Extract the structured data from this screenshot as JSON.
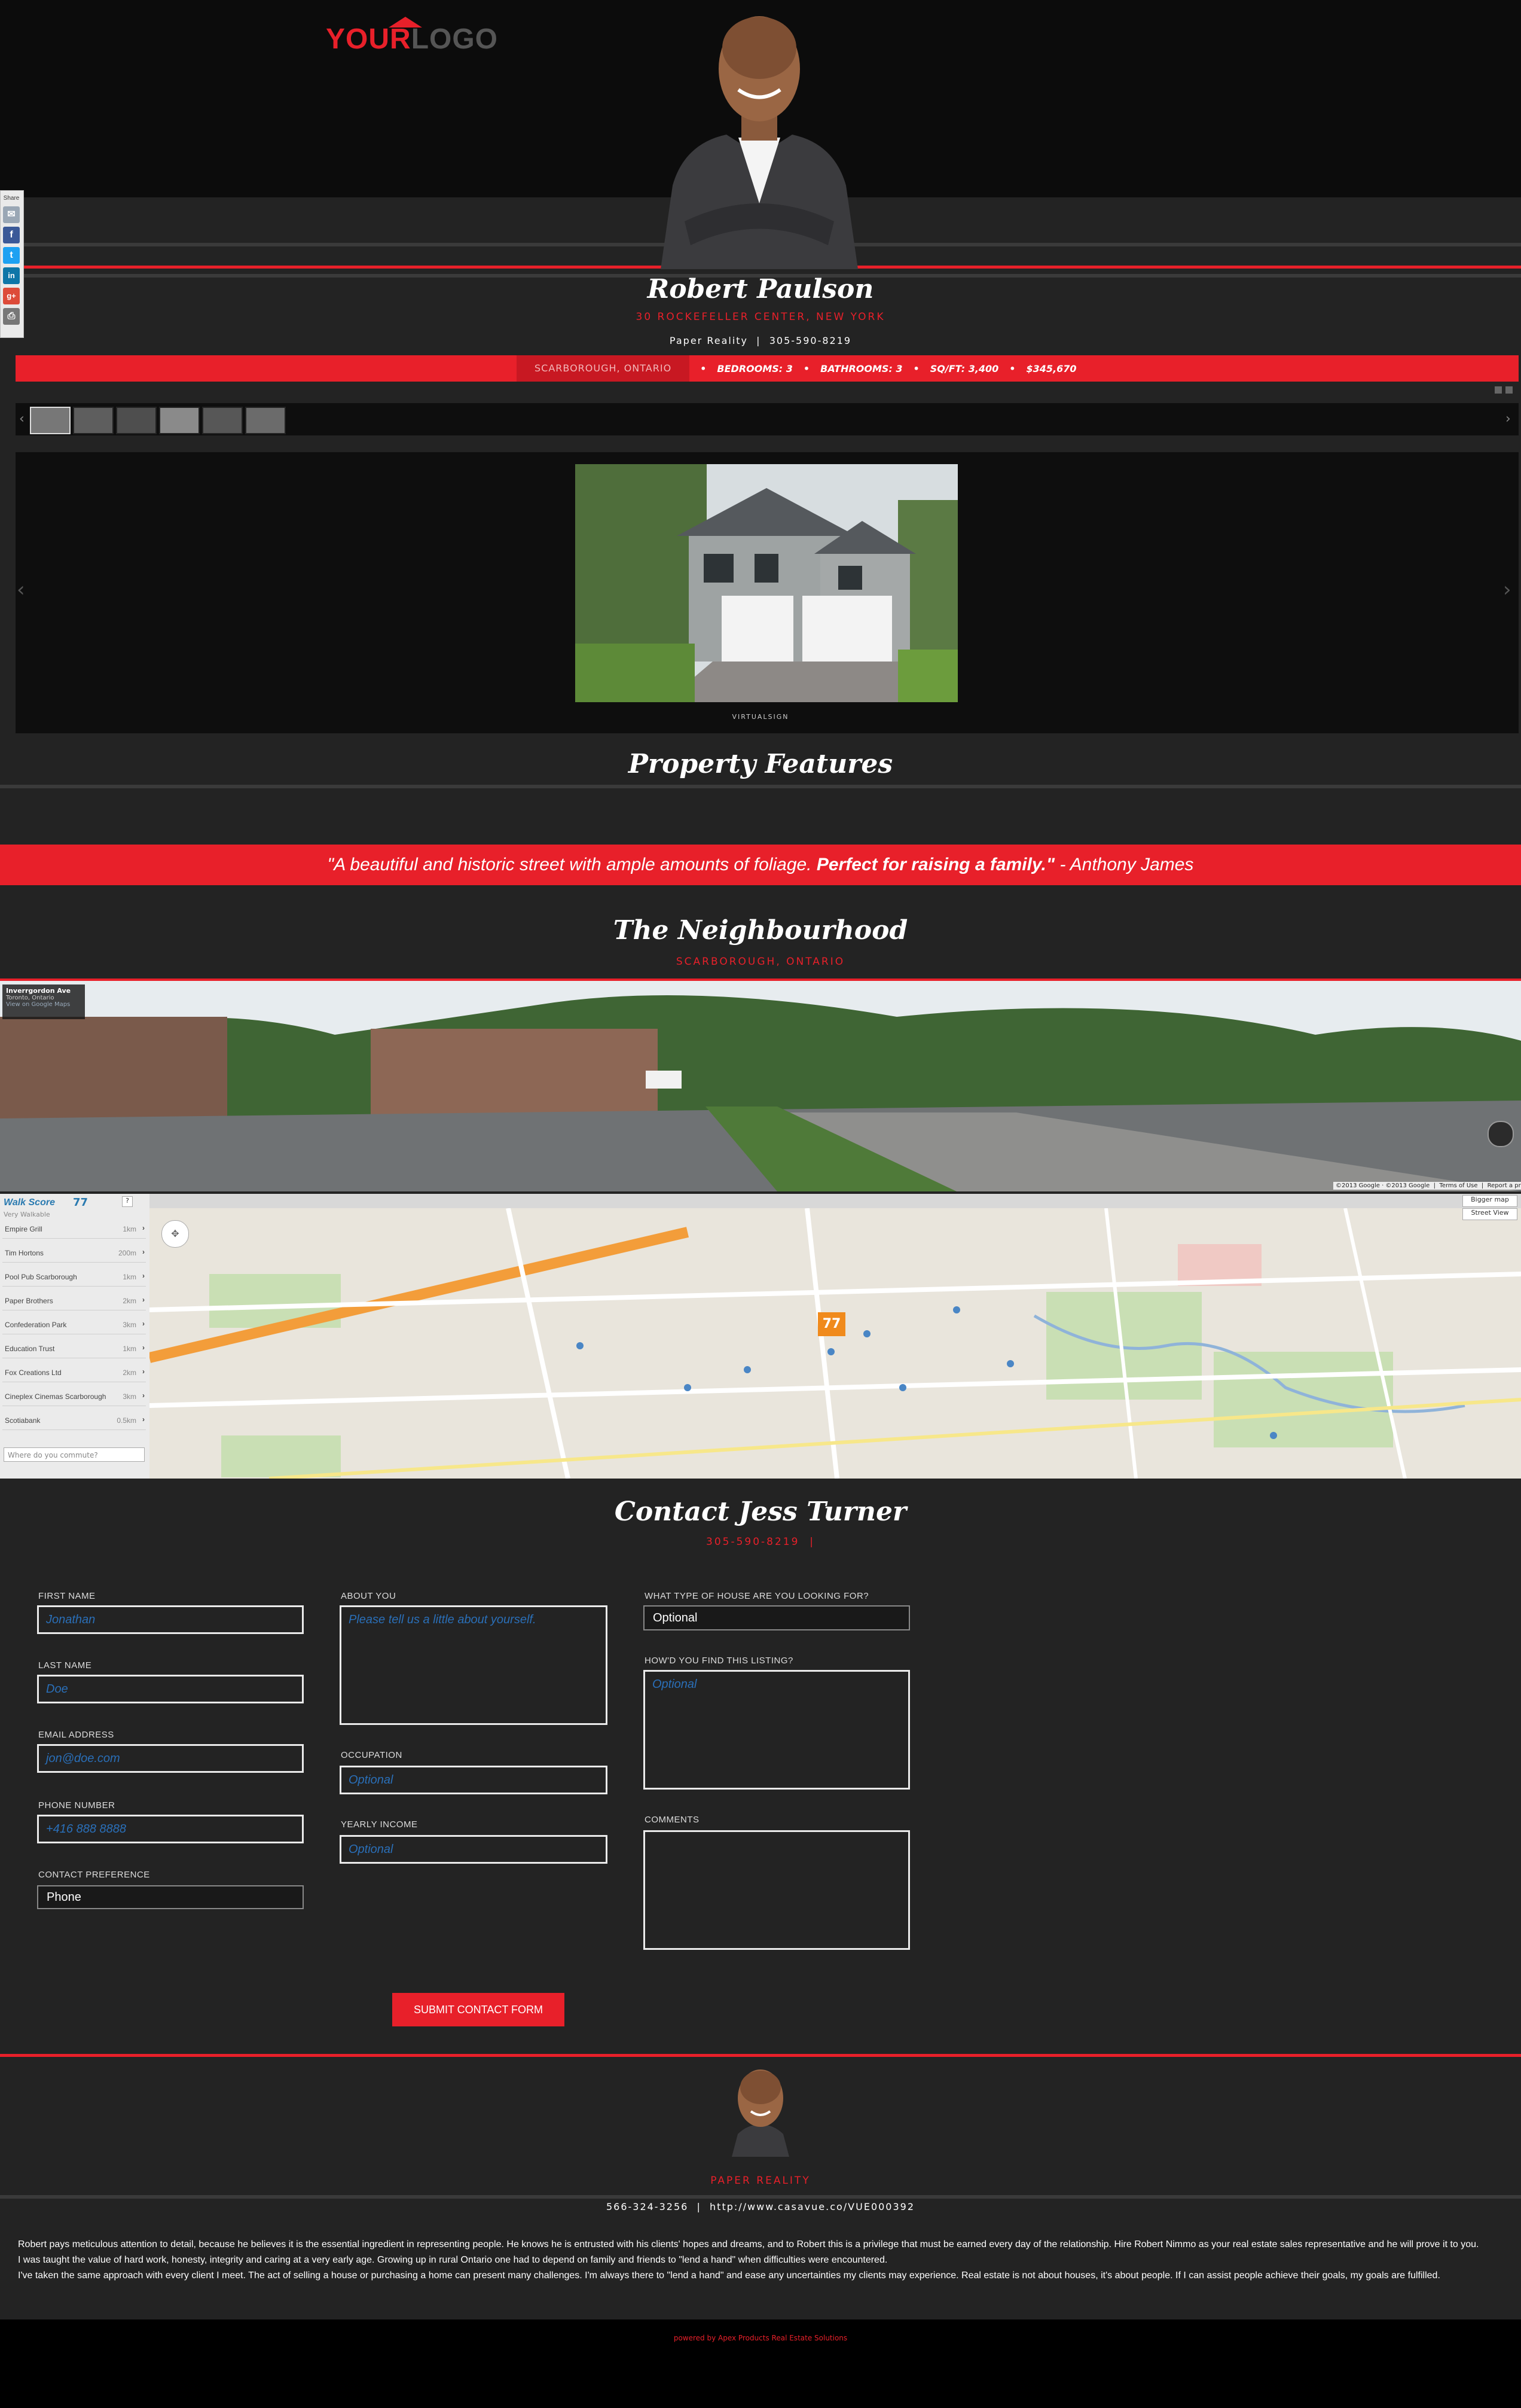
{
  "header": {
    "logo_your": "YOUR",
    "logo_logo": "LOGO"
  },
  "share": {
    "label": "Share",
    "buttons": [
      "email-share",
      "facebook",
      "twitter",
      "linkedin",
      "google-plus",
      "print"
    ]
  },
  "agent": {
    "name": "Robert Paulson",
    "address": "30 ROCKEFELLER CENTER, NEW YORK",
    "company_phone": "Paper Reality  |  305-590-8219"
  },
  "listing_bar": {
    "location": "SCARBOROUGH, ONTARIO",
    "bedrooms": "BEDROOMS: 3",
    "bathrooms": "BATHROOMS: 3",
    "sqft": "SQ/FT: 3,400",
    "price": "$345,670"
  },
  "gallery": {
    "caption": "VIRTUALSIGN"
  },
  "property_features": {
    "title": "Property Features"
  },
  "quote": {
    "part1": "\"A beautiful and historic street with ample amounts of foliage. ",
    "bold": "Perfect for raising a family.\"",
    "part2": " - Anthony James"
  },
  "neighbourhood": {
    "title": "The Neighbourhood",
    "location": "SCARBOROUGH, ONTARIO",
    "street_name": "Inverrgordon Ave",
    "street_city": "Toronto, Ontario",
    "street_link": "View on Google Maps",
    "map_copyright": "©2013 Google · ©2013 Google  |  Terms of Use  |  Report a problem",
    "walk_score_label": "Walk Score",
    "walk_score_value": "77",
    "walk_score_desc": "Very Walkable",
    "walk_items": [
      {
        "name": "Empire Grill",
        "dist": "1km"
      },
      {
        "name": "Tim Hortons",
        "dist": "200m"
      },
      {
        "name": "Pool Pub Scarborough",
        "dist": "1km"
      },
      {
        "name": "Paper Brothers",
        "dist": "2km"
      },
      {
        "name": "Confederation Park",
        "dist": "3km"
      },
      {
        "name": "Education Trust",
        "dist": "1km"
      },
      {
        "name": "Fox Creations Ltd",
        "dist": "2km"
      },
      {
        "name": "Cineplex Cinemas Scarborough",
        "dist": "3km"
      },
      {
        "name": "Scotiabank",
        "dist": "0.5km"
      }
    ],
    "commute_placeholder": "Where do you commute?",
    "map_btn_bigger": "Bigger map",
    "map_btn_street": "Street View",
    "map_marker": "77"
  },
  "contact": {
    "title": "Contact Jess Turner",
    "phone": "305-590-8219  |",
    "first_name_label": "FIRST NAME",
    "first_name_ph": "Jonathan",
    "last_name_label": "LAST NAME",
    "last_name_ph": "Doe",
    "email_label": "EMAIL ADDRESS",
    "email_ph": "jon@doe.com",
    "phone_label": "PHONE NUMBER",
    "phone_ph": "+416 888 8888",
    "pref_label": "CONTACT PREFERENCE",
    "pref_value": "Phone",
    "about_label": "ABOUT YOU",
    "about_ph": "Please tell us a little about yourself.",
    "occupation_label": "OCCUPATION",
    "occupation_ph": "Optional",
    "income_label": "YEARLY INCOME",
    "income_ph": "Optional",
    "house_type_label": "WHAT TYPE OF HOUSE ARE YOU LOOKING FOR?",
    "house_type_value": "Optional",
    "found_label": "HOW'D YOU FIND THIS LISTING?",
    "found_ph": "Optional",
    "comments_label": "COMMENTS",
    "submit": "SUBMIT CONTACT FORM"
  },
  "footer": {
    "company": "PAPER REALITY",
    "contact_line": "566-324-3256  |  http://www.casavue.co/VUE000392",
    "bio1": "Robert pays meticulous attention to detail, because he believes it is the essential ingredient in representing people. He knows he is entrusted with his clients' hopes and dreams, and to Robert this is a privilege that must be earned every day of the relationship. Hire Robert Nimmo as your real estate sales representative and he will prove it to you.",
    "bio2": "I was taught the value of hard work, honesty, integrity and caring at a very early age. Growing up in rural Ontario one had to depend on family and friends to \"lend a hand\" when difficulties were encountered.",
    "bio3": "I've taken the same approach with every client I meet. The act of selling a house or purchasing a home can present many challenges. I'm always there to \"lend a hand\" and ease any uncertainties my clients may experience. Real estate is not about houses, it's about people. If I can assist people achieve their goals, my goals are fulfilled.",
    "powered": "powered by Apex Products Real Estate Solutions"
  }
}
